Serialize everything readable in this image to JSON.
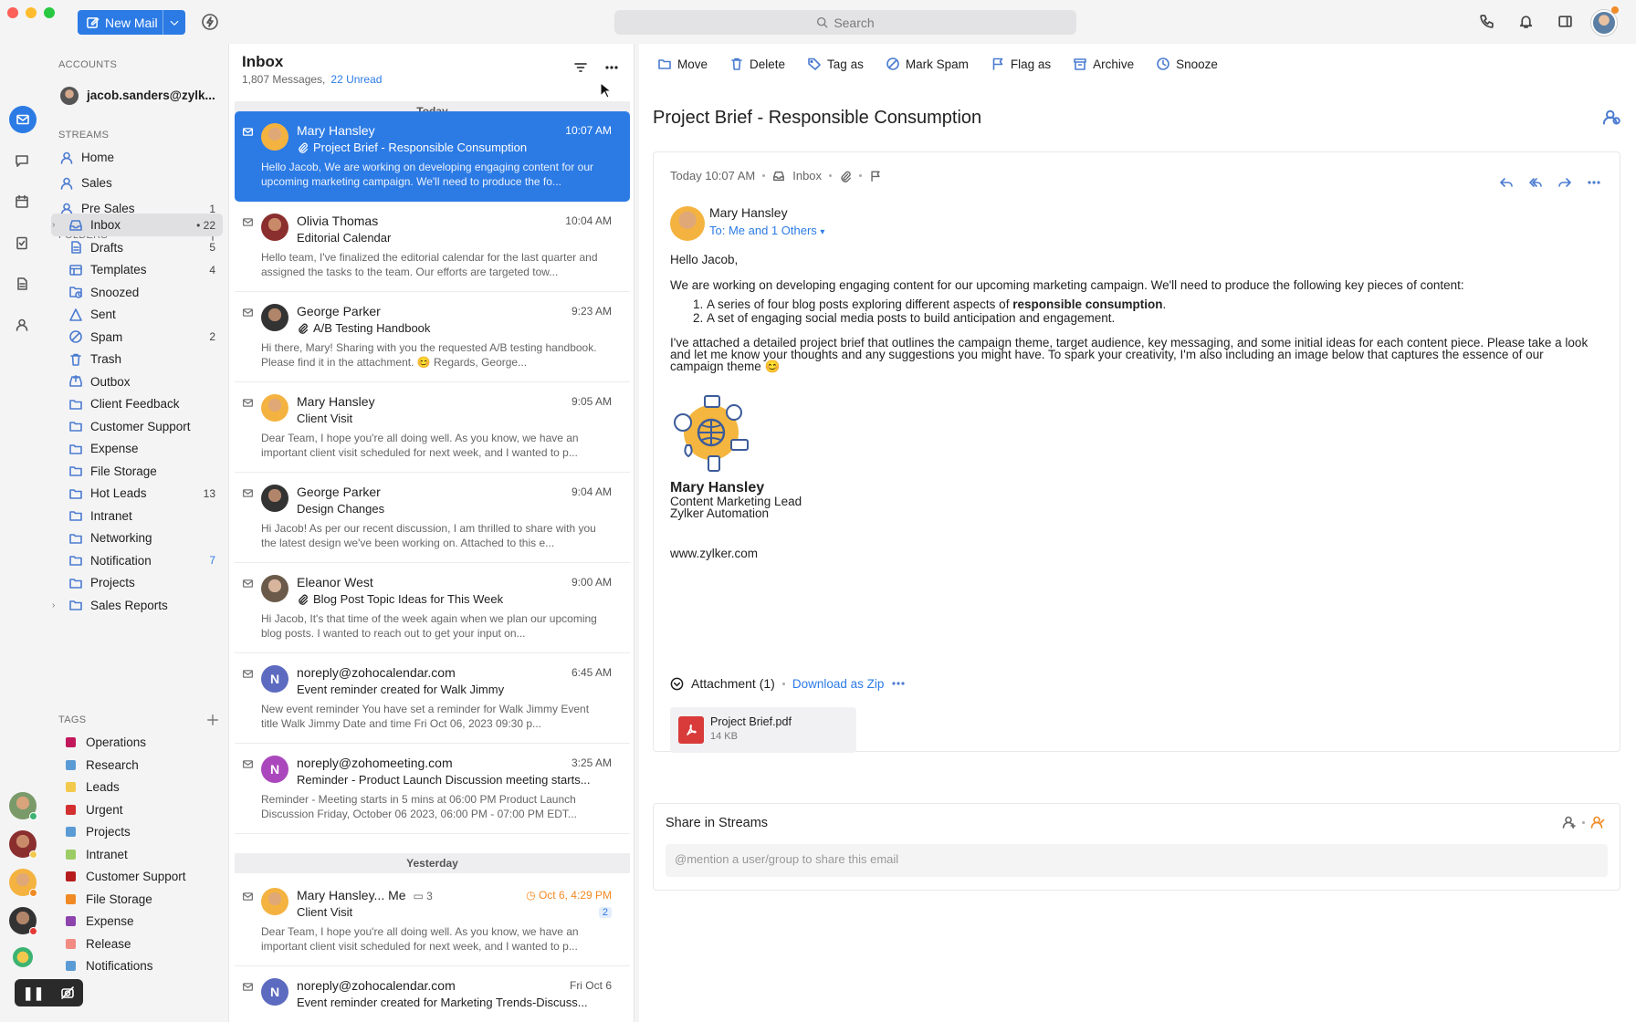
{
  "toolbar": {
    "new_mail": "New Mail",
    "search_placeholder": "Search"
  },
  "accounts": {
    "header": "ACCOUNTS",
    "email": "jacob.sanders@zylk..."
  },
  "streams": {
    "header": "STREAMS",
    "items": [
      {
        "label": "Home",
        "count": ""
      },
      {
        "label": "Sales",
        "count": ""
      },
      {
        "label": "Pre Sales",
        "count": "1"
      }
    ]
  },
  "folders": {
    "header": "FOLDERS",
    "items": [
      {
        "label": "Inbox",
        "count": "• 22",
        "icon": "inbox-icon"
      },
      {
        "label": "Drafts",
        "count": "5",
        "icon": "drafts-icon"
      },
      {
        "label": "Templates",
        "count": "4",
        "icon": "templates-icon"
      },
      {
        "label": "Snoozed",
        "count": "",
        "icon": "snoozed-icon"
      },
      {
        "label": "Sent",
        "count": "",
        "icon": "sent-icon"
      },
      {
        "label": "Spam",
        "count": "2",
        "icon": "spam-icon"
      },
      {
        "label": "Trash",
        "count": "",
        "icon": "trash-icon"
      },
      {
        "label": "Outbox",
        "count": "",
        "icon": "outbox-icon"
      },
      {
        "label": "Client Feedback",
        "count": "",
        "icon": "folder-icon"
      },
      {
        "label": "Customer Support",
        "count": "",
        "icon": "folder-icon"
      },
      {
        "label": "Expense",
        "count": "",
        "icon": "folder-icon"
      },
      {
        "label": "File Storage",
        "count": "",
        "icon": "folder-icon"
      },
      {
        "label": "Hot Leads",
        "count": "13",
        "icon": "folder-icon"
      },
      {
        "label": "Intranet",
        "count": "",
        "icon": "folder-icon"
      },
      {
        "label": "Networking",
        "count": "",
        "icon": "folder-icon"
      },
      {
        "label": "Notification",
        "count": "7",
        "icon": "folder-icon"
      },
      {
        "label": "Projects",
        "count": "",
        "icon": "folder-icon"
      },
      {
        "label": "Sales Reports",
        "count": "",
        "icon": "folder-icon"
      }
    ]
  },
  "tags": {
    "header": "TAGS",
    "items": [
      {
        "label": "Operations",
        "color": "#c2185b"
      },
      {
        "label": "Research",
        "color": "#5b9bd5"
      },
      {
        "label": "Leads",
        "color": "#f2c94c"
      },
      {
        "label": "Urgent",
        "color": "#d32f2f"
      },
      {
        "label": "Projects",
        "color": "#5b9bd5"
      },
      {
        "label": "Intranet",
        "color": "#9ccc65"
      },
      {
        "label": "Customer Support",
        "color": "#b71c1c"
      },
      {
        "label": "File Storage",
        "color": "#f08a24"
      },
      {
        "label": "Expense",
        "color": "#8e44ad"
      },
      {
        "label": "Release",
        "color": "#f28b82"
      },
      {
        "label": "Notifications",
        "color": "#5b9bd5"
      }
    ]
  },
  "list": {
    "title": "Inbox",
    "count": "1,807 Messages,",
    "unread": "22 Unread",
    "today": "Today",
    "yesterday": "Yesterday",
    "messages": [
      {
        "from": "Mary Hansley",
        "time": "10:07 AM",
        "subject": "Project Brief - Responsible Consumption",
        "attach": true,
        "preview": "Hello Jacob, We are working on developing engaging content for our upcoming marketing campaign. We'll need to produce the fo..."
      },
      {
        "from": "Olivia Thomas",
        "time": "10:04 AM",
        "subject": "Editorial Calendar",
        "attach": false,
        "preview": "Hello team, I've finalized the editorial calendar for the last quarter and assigned the tasks to the team. Our efforts are targeted tow..."
      },
      {
        "from": "George Parker",
        "time": "9:23 AM",
        "subject": "A/B Testing Handbook",
        "attach": true,
        "preview": "Hi there, Mary! Sharing with you the requested A/B testing handbook. Please find it in the attachment. 😊 Regards, George..."
      },
      {
        "from": "Mary Hansley",
        "time": "9:05 AM",
        "subject": "Client Visit",
        "attach": false,
        "preview": "Dear Team, I hope you're all doing well. As you know, we have an important client visit scheduled for next week, and I wanted to p..."
      },
      {
        "from": "George Parker",
        "time": "9:04 AM",
        "subject": "Design Changes",
        "attach": false,
        "preview": "Hi Jacob! As per our recent discussion, I am thrilled to share with you the latest design we've been working on. Attached to this e..."
      },
      {
        "from": "Eleanor West",
        "time": "9:00 AM",
        "subject": "Blog Post Topic Ideas for This Week",
        "attach": true,
        "preview": "Hi Jacob, It's that time of the week again when we plan our upcoming blog posts. I wanted to reach out to get your input on..."
      },
      {
        "from": "noreply@zohocalendar.com",
        "time": "6:45 AM",
        "subject": "Event reminder created for Walk Jimmy",
        "attach": false,
        "initial": "N",
        "preview": "New event reminder You have set a reminder for Walk Jimmy Event title Walk Jimmy Date and time Fri Oct 06, 2023 09:30 p..."
      },
      {
        "from": "noreply@zohomeeting.com",
        "time": "3:25 AM",
        "subject": "Reminder - Product Launch Discussion meeting starts...",
        "attach": false,
        "initial": "N",
        "preview": "Reminder - Meeting starts in 5 mins at 06:00 PM Product Launch Discussion Friday, October 06 2023, 06:00 PM - 07:00 PM EDT..."
      },
      {
        "from": "Mary Hansley... Me",
        "thread": "3",
        "time": "Oct 6, 4:29 PM",
        "badge": "2",
        "subject": "Client Visit",
        "attach": false,
        "preview": "Dear Team, I hope you're all doing well. As you know, we have an important client visit scheduled for next week, and I wanted to p..."
      },
      {
        "from": "noreply@zohocalendar.com",
        "time": "Fri Oct 6",
        "subject": "Event reminder created for Marketing Trends-Discuss...",
        "attach": false,
        "initial": "N",
        "preview": ""
      }
    ]
  },
  "reader": {
    "actions": [
      "Move",
      "Delete",
      "Tag as",
      "Mark Spam",
      "Flag as",
      "Archive",
      "Snooze"
    ],
    "subject": "Project Brief - Responsible Consumption",
    "meta_time": "Today 10:07 AM",
    "meta_folder": "Inbox",
    "sender": "Mary Hansley",
    "to": "To: Me and 1 Others",
    "greeting": "Hello Jacob,",
    "para1": "We are working on developing engaging content for our upcoming marketing campaign. We'll need to produce the following key pieces of content:",
    "li1_pre": "A series of four blog posts exploring different aspects of ",
    "li1_bold": "responsible consumption",
    "li1_post": ".",
    "li2": "A set of engaging social media posts to build anticipation and engagement.",
    "para2": "I've attached a detailed project brief that outlines the campaign theme, target audience, key messaging, and some initial ideas for each content piece. Please take a look and let me know your thoughts and any suggestions you might have. To spark your creativity, I'm also including an image below that captures the essence of our campaign theme 😊",
    "sig_name": "Mary Hansley",
    "sig_title": "Content Marketing Lead",
    "sig_company": "Zylker Automation",
    "sig_url": "www.zylker.com",
    "attachment_header": "Attachment (1)",
    "download_zip": "Download as Zip",
    "file_name": "Project Brief.pdf",
    "file_size": "14 KB",
    "share_title": "Share in Streams",
    "share_placeholder": "@mention a user/group to share this email"
  },
  "colors": {
    "accent": "#2c7be5",
    "selected_row": "#2c7be5",
    "time_warning": "#f08a24"
  }
}
